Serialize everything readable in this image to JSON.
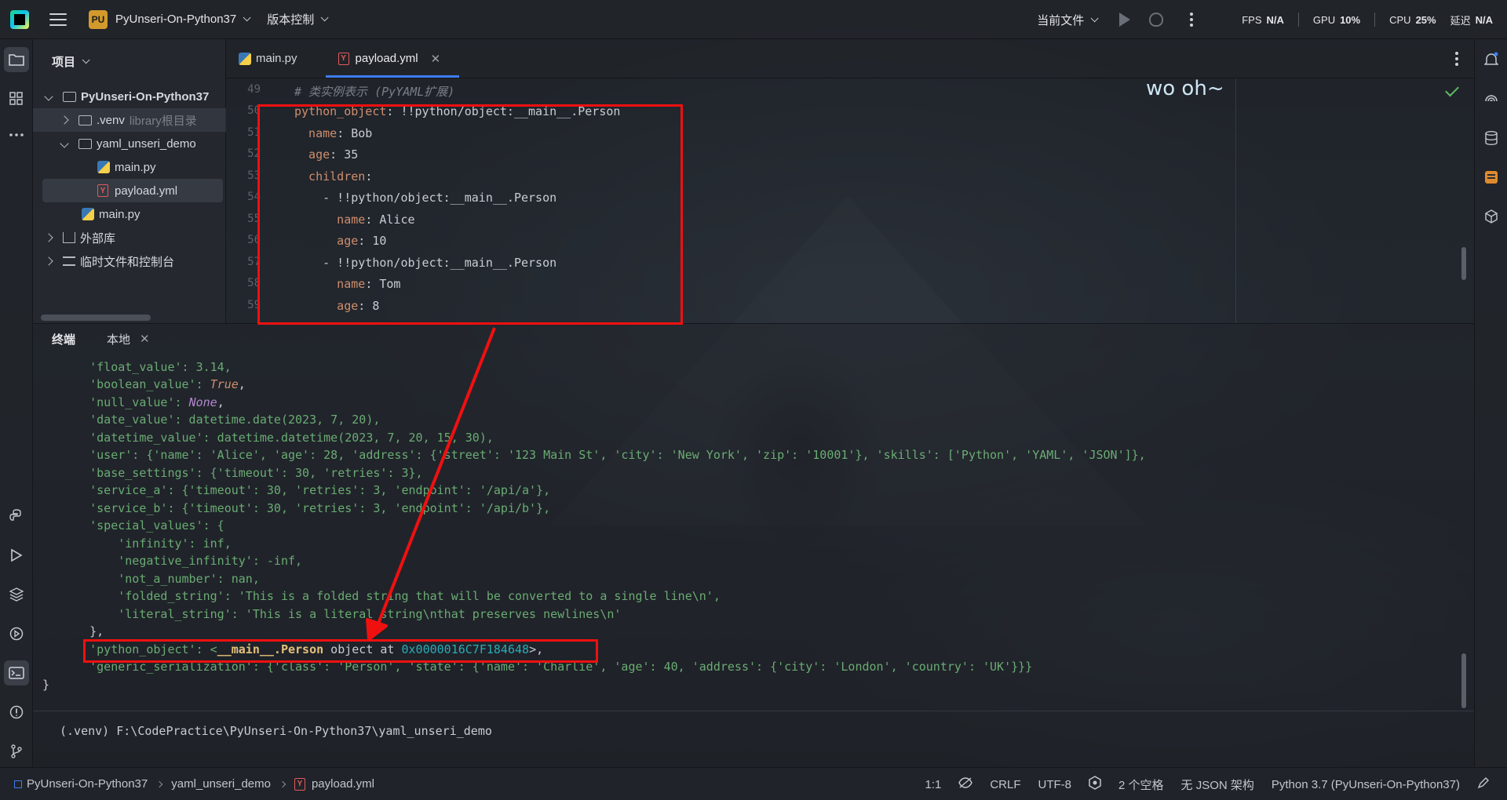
{
  "titlebar": {
    "project_badge": "PU",
    "project_name": "PyUnseri-On-Python37",
    "vcs_label": "版本控制",
    "current_file_label": "当前文件",
    "fps_label": "FPS",
    "fps_value": "N/A",
    "gpu_label": "GPU",
    "gpu_value": "10%",
    "cpu_label": "CPU",
    "cpu_value": "25%",
    "latency_label": "延迟",
    "latency_value": "N/A"
  },
  "project_panel": {
    "header": "项目",
    "items": [
      {
        "label": "PyUnseri-On-Python37"
      },
      {
        "label": ".venv",
        "hint": "library根目录"
      },
      {
        "label": "yaml_unseri_demo"
      },
      {
        "label": "main.py"
      },
      {
        "label": "payload.yml"
      },
      {
        "label": "main.py"
      },
      {
        "label": "外部库"
      },
      {
        "label": "临时文件和控制台"
      }
    ]
  },
  "editor": {
    "tabs": [
      {
        "label": "main.py"
      },
      {
        "label": "payload.yml"
      }
    ],
    "overlay_text": "wo oh~",
    "line_numbers": [
      "49",
      "50",
      "51",
      "52",
      "53",
      "54",
      "55",
      "56",
      "57",
      "58",
      "59"
    ],
    "lines": [
      {
        "comment": "# 类实例表示 (PyYAML扩展)"
      },
      {
        "key": "python_object",
        "rest": ": !!python/object:__main__.Person"
      },
      {
        "key": "  name",
        "rest": ": Bob"
      },
      {
        "key": "  age",
        "rest": ": 35"
      },
      {
        "key": "  children",
        "rest": ":"
      },
      {
        "key": "",
        "rest": "    - !!python/object:__main__.Person"
      },
      {
        "key": "      name",
        "rest": ": Alice"
      },
      {
        "key": "      age",
        "rest": ": 10"
      },
      {
        "key": "",
        "rest": "    - !!python/object:__main__.Person"
      },
      {
        "key": "      name",
        "rest": ": Tom"
      },
      {
        "key": "      age",
        "rest": ": 8"
      }
    ]
  },
  "terminal": {
    "title": "终端",
    "tab_label": "本地",
    "output": {
      "l01": "    'float_value': 3.14,",
      "l02_key": "    'boolean_value': ",
      "l02_val": "True",
      "l02_end": ",",
      "l03_key": "    'null_value': ",
      "l03_val": "None",
      "l03_end": ",",
      "l04": "    'date_value': datetime.date(2023, 7, 20),",
      "l05": "    'datetime_value': datetime.datetime(2023, 7, 20, 15, 30),",
      "l06": "    'user': {'name': 'Alice', 'age': 28, 'address': {'street': '123 Main St', 'city': 'New York', 'zip': '10001'}, 'skills': ['Python', 'YAML', 'JSON']},",
      "l07": "    'base_settings': {'timeout': 30, 'retries': 3},",
      "l08": "    'service_a': {'timeout': 30, 'retries': 3, 'endpoint': '/api/a'},",
      "l09": "    'service_b': {'timeout': 30, 'retries': 3, 'endpoint': '/api/b'},",
      "l10": "    'special_values': {",
      "l11": "        'infinity': inf,",
      "l12": "        'negative_infinity': -inf,",
      "l13": "        'not_a_number': nan,",
      "l14": "        'folded_string': 'This is a folded string that will be converted to a single line\\n',",
      "l15": "        'literal_string': 'This is a literal string\\nthat preserves newlines\\n'",
      "l16": "    },",
      "l17_key": "    'python_object': <",
      "l17_cls": "__main__.Person",
      "l17_mid": " object at ",
      "l17_addr": "0x0000016C7F184648",
      "l17_end": ">,",
      "l18": "    'generic_serialization': {'class': 'Person', 'state': {'name': 'Charlie', 'age': 40, 'address': {'city': 'London', 'country': 'UK'}}}",
      "l19": "}"
    },
    "prompt": "(.venv) F:\\CodePractice\\PyUnseri-On-Python37\\yaml_unseri_demo"
  },
  "statusbar": {
    "crumbs": [
      "PyUnseri-On-Python37",
      "yaml_unseri_demo",
      "payload.yml"
    ],
    "position": "1:1",
    "line_ending": "CRLF",
    "encoding": "UTF-8",
    "indent": "2 个空格",
    "schema": "无 JSON 架构",
    "interpreter": "Python 3.7 (PyUnseri-On-Python37)"
  },
  "colors": {
    "accent": "#3d7df2",
    "highlight_box": "#f01010",
    "yaml_key": "#cf8e6d",
    "string": "#6aab73",
    "number": "#2aacb8"
  }
}
